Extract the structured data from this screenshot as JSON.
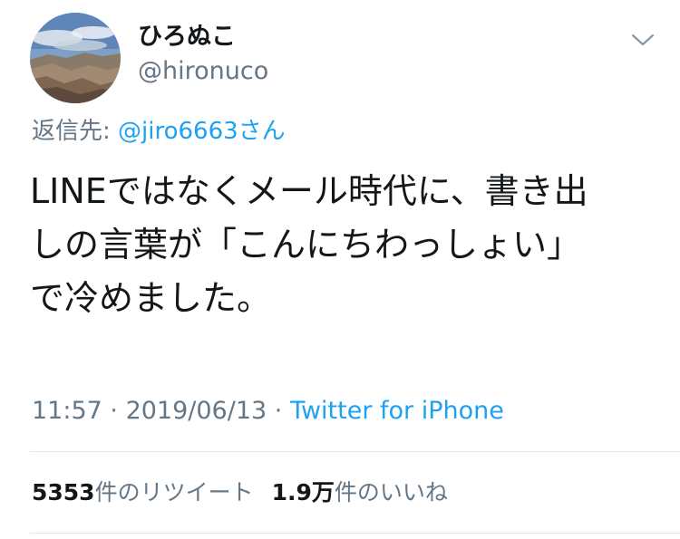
{
  "author": {
    "display_name": "ひろぬこ",
    "handle": "@hironuco",
    "avatar_icon": "landscape-avatar-icon"
  },
  "menu_icon": "chevron-down-icon",
  "reply": {
    "prefix": "返信先: ",
    "mention": "@jiro6663",
    "suffix": "さん"
  },
  "tweet": {
    "lines": [
      "LINEではなくメール時代に、書き出",
      "しの言葉が「こんにちわっしょい」",
      "で冷めました。"
    ]
  },
  "meta": {
    "time": "11:57",
    "sep1": " · ",
    "date": "2019/06/13",
    "sep2": " · ",
    "source": "Twitter for iPhone"
  },
  "stats": {
    "retweets_count": "5353",
    "retweets_label": "件のリツイート",
    "likes_count": "1.9万",
    "likes_label": "件のいいね"
  },
  "colors": {
    "link": "#1da1f2",
    "muted": "#657786",
    "text": "#14171a",
    "divider": "#e1e8ed"
  }
}
